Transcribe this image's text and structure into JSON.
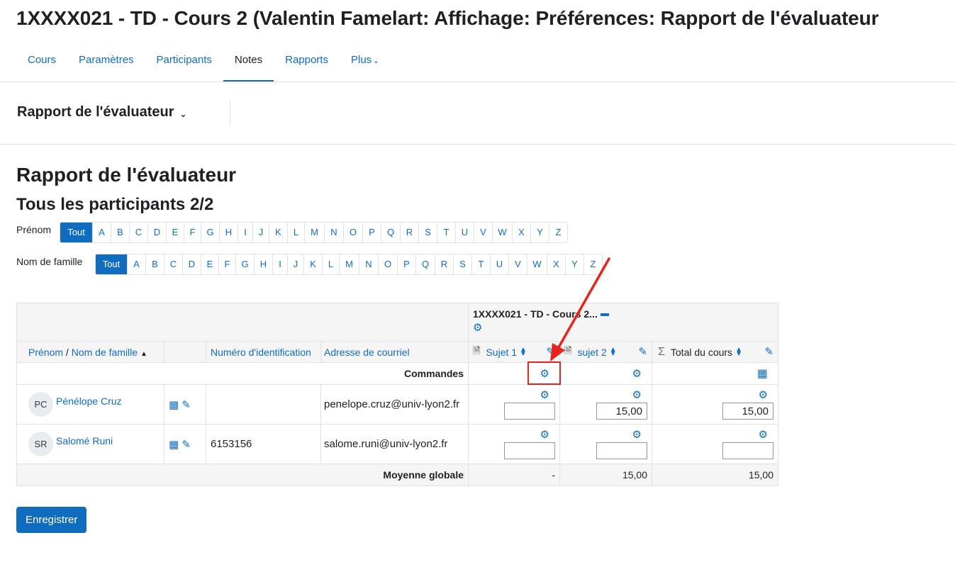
{
  "page": {
    "title": "1XXXX021 - TD - Cours 2 (Valentin Famelart: Affichage: Préférences: Rapport de l'évaluateur"
  },
  "nav": {
    "items": [
      {
        "label": "Cours"
      },
      {
        "label": "Paramètres"
      },
      {
        "label": "Participants"
      },
      {
        "label": "Notes",
        "active": true
      },
      {
        "label": "Rapports"
      },
      {
        "label": "Plus"
      }
    ]
  },
  "report_selector": {
    "label": "Rapport de l'évaluateur"
  },
  "heading": "Rapport de l'évaluateur",
  "subheading": "Tous les participants 2/2",
  "filters": {
    "firstname_label": "Prénom",
    "lastname_label": "Nom de famille",
    "all_label": "Tout",
    "letters": [
      "A",
      "B",
      "C",
      "D",
      "E",
      "F",
      "G",
      "H",
      "I",
      "J",
      "K",
      "L",
      "M",
      "N",
      "O",
      "P",
      "Q",
      "R",
      "S",
      "T",
      "U",
      "V",
      "W",
      "X",
      "Y",
      "Z"
    ]
  },
  "grader": {
    "category_header": "1XXXX021 - TD - Cours 2...",
    "col_firstname": "Prénom",
    "col_separator": "/",
    "col_lastname": "Nom de famille",
    "col_idnumber": "Numéro d'identification",
    "col_email": "Adresse de courriel",
    "col_item1": "Sujet 1",
    "col_item2": "sujet 2",
    "col_total": "Total du cours",
    "commands_label": "Commandes",
    "students": [
      {
        "initials": "PC",
        "name": "Pénélope Cruz",
        "idnumber": "",
        "email": "penelope.cruz@univ-lyon2.fr",
        "grade1": "",
        "grade2": "15,00",
        "total": "15,00"
      },
      {
        "initials": "SR",
        "name": "Salomé Runi",
        "idnumber": "6153156",
        "email": "salome.runi@univ-lyon2.fr",
        "grade1": "",
        "grade2": "",
        "total": ""
      }
    ],
    "average_label": "Moyenne globale",
    "average_item1": "-",
    "average_item2": "15,00",
    "average_total": "15,00"
  },
  "save_button": "Enregistrer",
  "colors": {
    "accent": "#0f6cbf",
    "highlight": "#e8231e"
  },
  "icons": [
    "gear-icon",
    "pencil-icon",
    "sort-icon",
    "assignment-icon",
    "sigma-icon",
    "calculator-icon",
    "table-icon"
  ]
}
